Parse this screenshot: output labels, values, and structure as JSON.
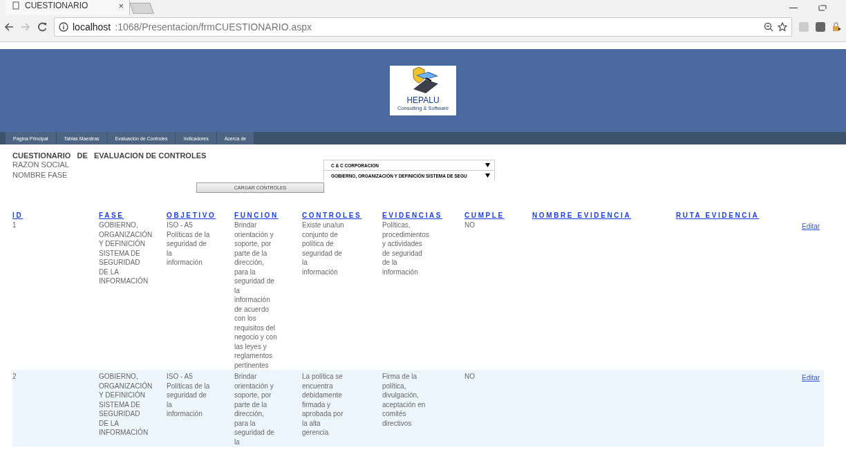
{
  "browser": {
    "tab_title": "CUESTIONARIO",
    "tab_close": "×",
    "url_host": "localhost",
    "url_path": ":1068/Presentacion/frmCUESTIONARIO.aspx"
  },
  "header": {
    "logo_title": "HEPALU",
    "logo_subtitle": "Consulting & Software"
  },
  "nav": [
    {
      "label": "Pagina Principal"
    },
    {
      "label": "Tablas Maestras"
    },
    {
      "label": "Evaluación de Controles"
    },
    {
      "label": "Indicadores"
    },
    {
      "label": "Acerca de"
    }
  ],
  "form": {
    "title": "CUESTIONARIO   DE   EVALUACION DE CONTROLES",
    "fields": [
      {
        "label": "RAZON SOCIAL",
        "value": "C & C CORPORACION"
      },
      {
        "label": "NOMBRE FASE",
        "value": "GOBIERNO, ORGANIZACIÓN Y DEFINICIÓN SISTEMA DE SEGU"
      }
    ],
    "button": "CARGAR CONTROLES"
  },
  "table": {
    "columns": [
      "ID",
      "FASE",
      "OBJETIVO",
      "FUNCION",
      "CONTROLES",
      "EVIDENCIAS",
      "CUMPLE",
      "NOMBRE EVIDENCIA",
      "RUTA EVIDENCIA"
    ],
    "rows": [
      {
        "cells": [
          "1",
          "GOBIERNO,\nORGANIZACIÓN\nY DEFINICIÓN\nSISTEMA DE\nSEGURIDAD\nDE LA\nINFORMACIÓN",
          "ISO - A5\nPolíticas de la\nseguridad de\nla\ninformación",
          "Brindar\norientación y\nsoporte, por\nparte de la\ndirección,\npara la\nseguridad de\nla\ninformación\nde acuerdo\ncon los\nrequisitos del\nnegocio y con\nlas leyes y\nreglamentos\npertinentes",
          "Existe una/un\nconjunto de\npolítica de\nseguridad de\nla\ninformación",
          "Políticas,\nprocedimientos\ny actividades\nde seguridad\nde la\ninformación",
          "NO"
        ],
        "action": "Editar"
      },
      {
        "cells": [
          "2",
          "GOBIERNO,\nORGANIZACIÓN\nY DEFINICIÓN\nSISTEMA DE\nSEGURIDAD\nDE LA\nINFORMACIÓN",
          "ISO - A5\nPolíticas de la\nseguridad de\nla\ninformación",
          "Brindar\norientación y\nsoporte, por\nparte de la\ndirección,\npara la\nseguridad de\nla",
          "La política se\nencuentra\ndebidamente\nfirmada y\naprobada por\nla alta\ngerencia",
          "Firma de la\npolítica,\ndivulgación,\naceptación en\ncomités\ndirectivos",
          "NO"
        ],
        "action": "Editar"
      }
    ]
  }
}
